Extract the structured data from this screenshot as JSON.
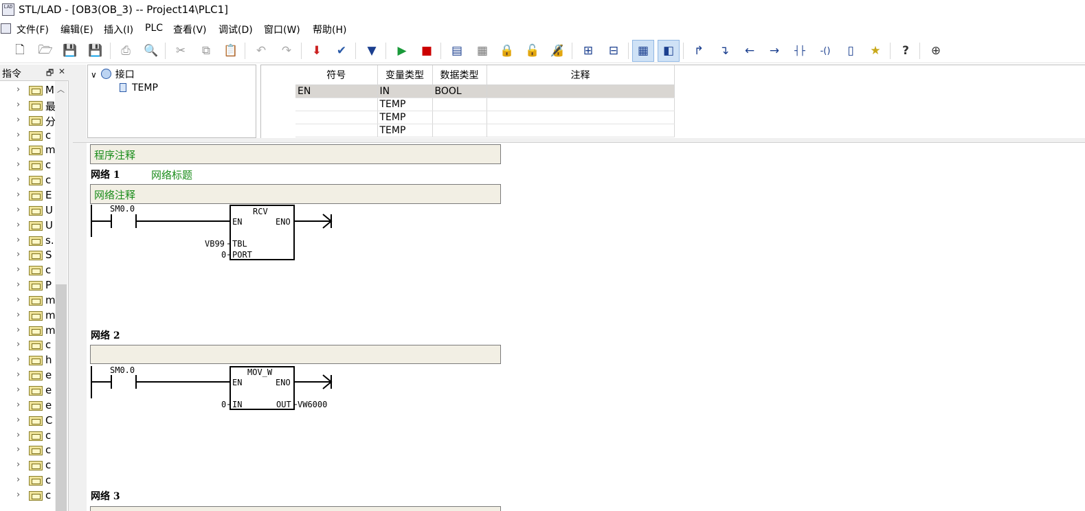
{
  "window": {
    "title": "STL/LAD - [OB3(OB_3) -- Project14\\PLC1]",
    "icon_text": "LAD"
  },
  "menu": [
    {
      "label": "文件(F)"
    },
    {
      "label": "编辑(E)"
    },
    {
      "label": "插入(I)"
    },
    {
      "label": "PLC"
    },
    {
      "label": "查看(V)"
    },
    {
      "label": "调试(D)"
    },
    {
      "label": "窗口(W)"
    },
    {
      "label": "帮助(H)"
    }
  ],
  "toolbar": {
    "buttons": [
      {
        "icon": "new-file-icon",
        "glyph": "🗋"
      },
      {
        "icon": "open-folder-icon",
        "glyph": "🗁"
      },
      {
        "icon": "save-icon",
        "glyph": "💾"
      },
      {
        "icon": "save-all-icon",
        "glyph": "💾"
      },
      {
        "icon": "print-icon",
        "glyph": "⎙"
      },
      {
        "icon": "print-preview-icon",
        "glyph": "🔍"
      },
      {
        "icon": "cut-icon",
        "glyph": "✂"
      },
      {
        "icon": "copy-icon",
        "glyph": "⧉"
      },
      {
        "icon": "paste-icon",
        "glyph": "📋"
      },
      {
        "icon": "undo-icon",
        "glyph": "↶"
      },
      {
        "icon": "redo-icon",
        "glyph": "↷"
      },
      {
        "icon": "download-icon",
        "glyph": "⬇"
      },
      {
        "icon": "check-icon",
        "glyph": "✔"
      },
      {
        "icon": "compile-icon",
        "glyph": "▼"
      },
      {
        "icon": "run-icon",
        "glyph": "▶"
      },
      {
        "icon": "stop-icon",
        "glyph": "■"
      },
      {
        "icon": "module-icon",
        "glyph": "▤"
      },
      {
        "icon": "module-list-icon",
        "glyph": "▦"
      },
      {
        "icon": "lock-icon",
        "glyph": "🔒"
      },
      {
        "icon": "unlock-icon",
        "glyph": "🔓"
      },
      {
        "icon": "lock-blue-icon",
        "glyph": "🔏"
      },
      {
        "icon": "insert-network-icon",
        "glyph": "⊞"
      },
      {
        "icon": "delete-network-icon",
        "glyph": "⊟"
      },
      {
        "icon": "view-table-icon",
        "glyph": "▦"
      },
      {
        "icon": "view-split-icon",
        "glyph": "◧"
      },
      {
        "icon": "branch-up-icon",
        "glyph": "↱"
      },
      {
        "icon": "branch-down-icon",
        "glyph": "↴"
      },
      {
        "icon": "arrow-left-icon",
        "glyph": "←"
      },
      {
        "icon": "arrow-right-icon",
        "glyph": "→"
      },
      {
        "icon": "contact-icon",
        "glyph": "┤├"
      },
      {
        "icon": "coil-icon",
        "glyph": "-()"
      },
      {
        "icon": "box-icon",
        "glyph": "▯"
      },
      {
        "icon": "star-icon",
        "glyph": "★"
      },
      {
        "icon": "help-icon",
        "glyph": "?"
      },
      {
        "icon": "zoom-icon",
        "glyph": "⊕"
      }
    ]
  },
  "left_panel": {
    "title": "指令",
    "float_glyph": "🗗",
    "close_glyph": "✕",
    "items": [
      {
        "label": "M"
      },
      {
        "label": "最"
      },
      {
        "label": "分"
      },
      {
        "label": "c"
      },
      {
        "label": "m"
      },
      {
        "label": "c"
      },
      {
        "label": "c"
      },
      {
        "label": "E"
      },
      {
        "label": "U"
      },
      {
        "label": "U"
      },
      {
        "label": "s."
      },
      {
        "label": "S"
      },
      {
        "label": "c"
      },
      {
        "label": "P"
      },
      {
        "label": "m"
      },
      {
        "label": "m"
      },
      {
        "label": "m"
      },
      {
        "label": "c"
      },
      {
        "label": "h"
      },
      {
        "label": "e"
      },
      {
        "label": "e"
      },
      {
        "label": "e"
      },
      {
        "label": "C"
      },
      {
        "label": "c"
      },
      {
        "label": "c"
      },
      {
        "label": "c"
      },
      {
        "label": "c"
      },
      {
        "label": "c"
      }
    ]
  },
  "interface_tree": {
    "root": "接口",
    "child": "TEMP"
  },
  "interface_table": {
    "headers": [
      "符号",
      "变量类型",
      "数据类型",
      "注释"
    ],
    "rows": [
      [
        "EN",
        "IN",
        "BOOL",
        ""
      ],
      [
        "",
        "TEMP",
        "",
        ""
      ],
      [
        "",
        "TEMP",
        "",
        ""
      ],
      [
        "",
        "TEMP",
        "",
        ""
      ]
    ]
  },
  "program": {
    "program_comment": "程序注释",
    "networks": [
      {
        "title": "网络 1",
        "subtitle": "网络标题",
        "comment": "网络注释",
        "contact": "SM0.0",
        "block": {
          "name": "RCV",
          "en": "EN",
          "eno": "ENO",
          "in1": "TBL",
          "in2": "PORT",
          "in1_val": "VB99",
          "in2_val": "0"
        }
      },
      {
        "title": "网络 2",
        "comment": "",
        "contact": "SM0.0",
        "block": {
          "name": "MOV_W",
          "en": "EN",
          "eno": "ENO",
          "in1": "IN",
          "out1": "OUT",
          "in1_val": "0",
          "out1_val": "VW6000"
        }
      },
      {
        "title": "网络 3"
      }
    ]
  }
}
